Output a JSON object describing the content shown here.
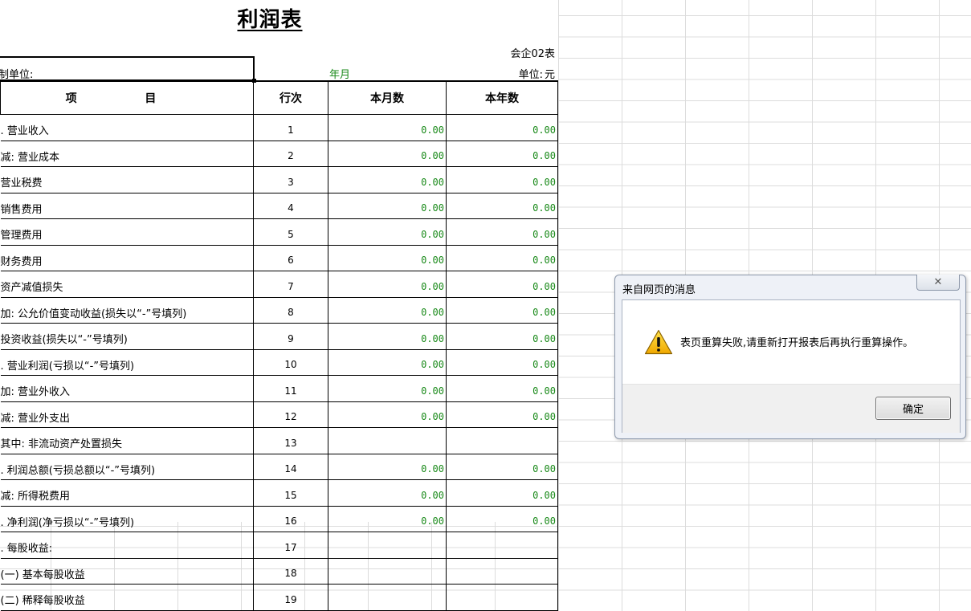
{
  "report": {
    "title": "利润表",
    "form_code": "会企02表",
    "org_label": "制单位:",
    "date_label": "年月",
    "unit_label": "单位:",
    "unit_value": "元",
    "headers": {
      "item": "项 目",
      "line": "行次",
      "month": "本月数",
      "year": "本年数"
    },
    "rows": [
      {
        "item": ". 营业收入",
        "line": "1",
        "month": "0.00",
        "year": "0.00",
        "indent": 0
      },
      {
        "item": "减: 营业成本",
        "line": "2",
        "month": "0.00",
        "year": "0.00",
        "indent": 1
      },
      {
        "item": "营业税费",
        "line": "3",
        "month": "0.00",
        "year": "0.00",
        "indent": 4
      },
      {
        "item": "销售费用",
        "line": "4",
        "month": "0.00",
        "year": "0.00",
        "indent": 4
      },
      {
        "item": "管理费用",
        "line": "5",
        "month": "0.00",
        "year": "0.00",
        "indent": 4
      },
      {
        "item": "财务费用",
        "line": "6",
        "month": "0.00",
        "year": "0.00",
        "indent": 4
      },
      {
        "item": "资产减值损失",
        "line": "7",
        "month": "0.00",
        "year": "0.00",
        "indent": 4
      },
      {
        "item": "加: 公允价值变动收益(损失以“-”号填列)",
        "line": "8",
        "month": "0.00",
        "year": "0.00",
        "indent": 0
      },
      {
        "item": "投资收益(损失以“-”号填列)",
        "line": "9",
        "month": "0.00",
        "year": "0.00",
        "indent": 2
      },
      {
        "item": ". 营业利润(亏损以“-”号填列)",
        "line": "10",
        "month": "0.00",
        "year": "0.00",
        "indent": 0
      },
      {
        "item": "加: 营业外收入",
        "line": "11",
        "month": "0.00",
        "year": "0.00",
        "indent": 0
      },
      {
        "item": "减: 营业外支出",
        "line": "12",
        "month": "0.00",
        "year": "0.00",
        "indent": 0
      },
      {
        "item": "其中: 非流动资产处置损失",
        "line": "13",
        "month": "",
        "year": "",
        "indent": 3
      },
      {
        "item": ". 利润总额(亏损总额以“-”号填列)",
        "line": "14",
        "month": "0.00",
        "year": "0.00",
        "indent": 0
      },
      {
        "item": "减: 所得税费用",
        "line": "15",
        "month": "0.00",
        "year": "0.00",
        "indent": 0
      },
      {
        "item": ". 净利润(净亏损以“-”号填列)",
        "line": "16",
        "month": "0.00",
        "year": "0.00",
        "indent": 0
      },
      {
        "item": ". 每股收益:",
        "line": "17",
        "month": "",
        "year": "",
        "indent": 0
      },
      {
        "item": "(一) 基本每股收益",
        "line": "18",
        "month": "",
        "year": "",
        "indent": 1
      },
      {
        "item": "(二) 稀释每股收益",
        "line": "19",
        "month": "",
        "year": "",
        "indent": 1
      }
    ]
  },
  "dialog": {
    "title": "来自网页的消息",
    "close_glyph": "✕",
    "message": "表页重算失败,请重新打开报表后再执行重算操作。",
    "ok_label": "确定",
    "icon": "warning-icon"
  }
}
